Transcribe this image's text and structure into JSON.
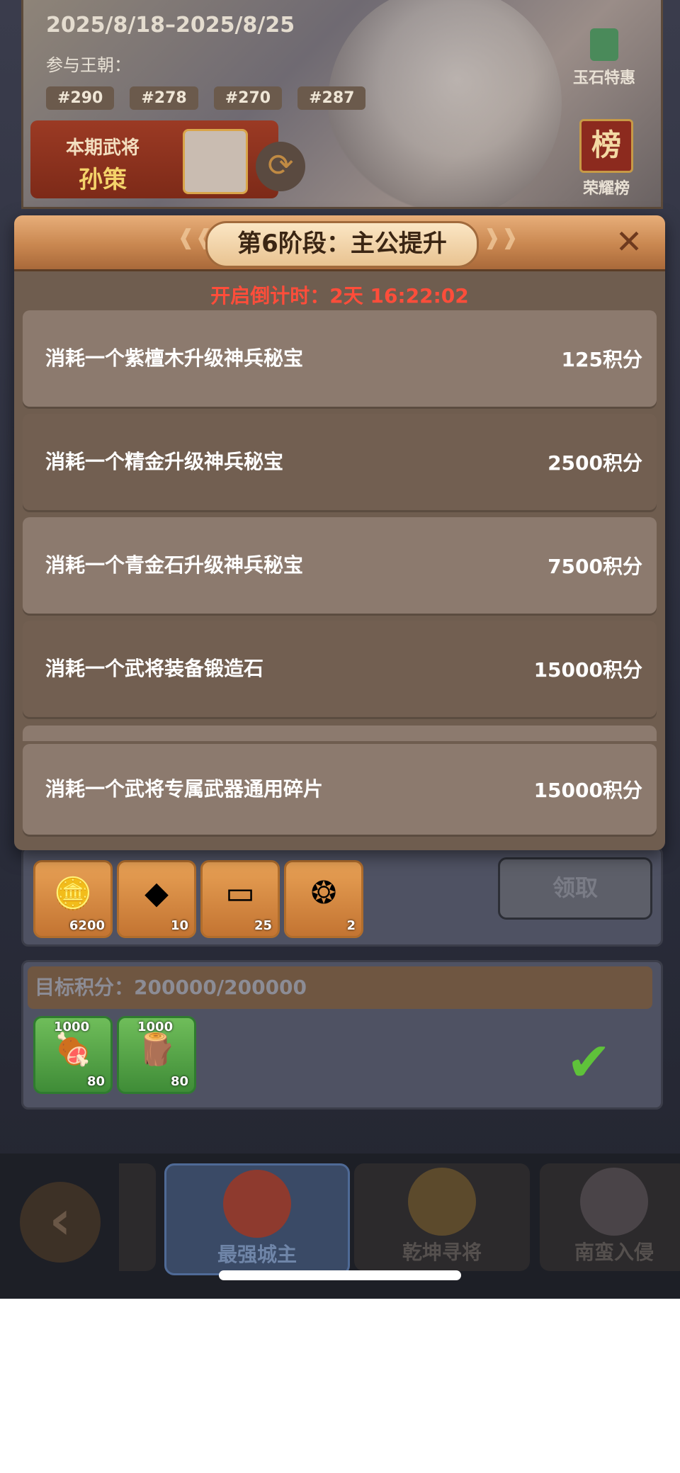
{
  "banner": {
    "date_range": "2025/8/18–2025/8/25",
    "participate_label": "参与王朝：",
    "dynasties": [
      "#290",
      "#278",
      "#270",
      "#287"
    ],
    "current_general_label": "本期武将",
    "current_general_name": "孙策",
    "jade_offer_label": "玉石特惠",
    "rank_icon_char": "榜",
    "honor_rank_label": "荣耀榜"
  },
  "modal": {
    "title": "第6阶段：主公提升",
    "countdown": "开启倒计时：2天 16:22:02",
    "tasks": [
      {
        "desc": "消耗一个紫檀木升级神兵秘宝",
        "points": "125积分"
      },
      {
        "desc": "消耗一个精金升级神兵秘宝",
        "points": "2500积分"
      },
      {
        "desc": "消耗一个青金石升级神兵秘宝",
        "points": "7500积分"
      },
      {
        "desc": "消耗一个武将装备锻造石",
        "points": "15000积分"
      },
      {
        "desc": "消耗一个武将专属武器通用碎片",
        "points": "15000积分"
      }
    ]
  },
  "rewards_panel": {
    "items": [
      {
        "icon": "gold-ingot-icon",
        "count": "6200"
      },
      {
        "icon": "ore-icon",
        "count": "10"
      },
      {
        "icon": "silver-bar-icon",
        "count": "25"
      },
      {
        "icon": "token-icon",
        "count": "2"
      }
    ],
    "claim_label": "领取"
  },
  "target_panel": {
    "label": "目标积分：200000/200000",
    "items": [
      {
        "icon": "meat-icon",
        "top": "1000",
        "count": "80"
      },
      {
        "icon": "wood-icon",
        "top": "1000",
        "count": "80"
      }
    ]
  },
  "tabbar": {
    "tabs": [
      "最强城主",
      "乾坤寻将",
      "南蛮入侵"
    ]
  },
  "colors": {
    "countdown_red": "#ff4d3a",
    "header_orange": "#c98750",
    "check_green": "#5fc23a"
  }
}
